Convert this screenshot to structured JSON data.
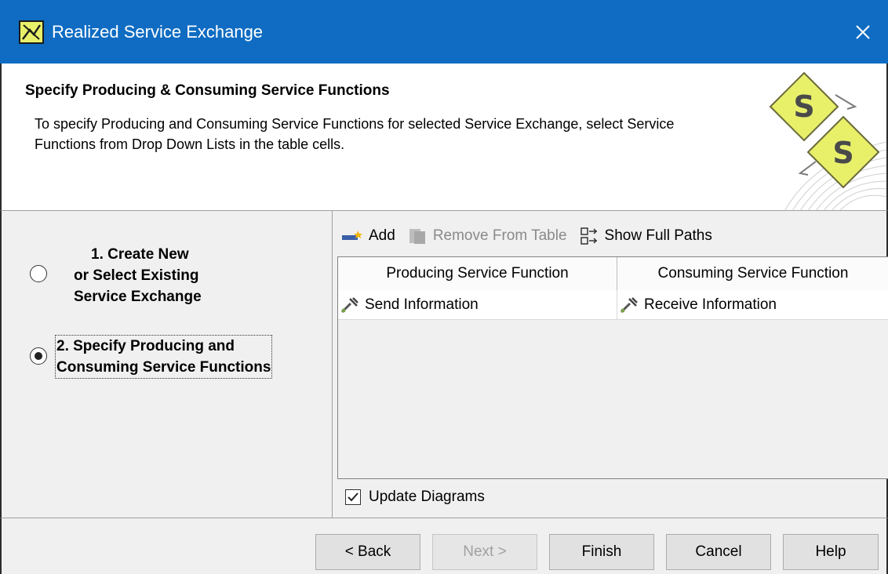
{
  "window": {
    "title": "Realized Service Exchange"
  },
  "header": {
    "title": "Specify Producing & Consuming Service Functions",
    "description": "To specify Producing and Consuming Service Functions for selected Service Exchange, select Service Functions from Drop Down Lists in the table cells."
  },
  "steps": [
    {
      "line1": "1. Create New",
      "line2": "or Select Existing",
      "line3": "Service Exchange",
      "selected": false
    },
    {
      "line1": "2. Specify Producing and",
      "line2": "Consuming Service Functions",
      "selected": true
    }
  ],
  "toolbar": {
    "add_label": "Add",
    "remove_label": "Remove From Table",
    "show_paths_label": "Show Full Paths"
  },
  "table": {
    "columns": [
      "Producing Service Function",
      "Consuming Service Function"
    ],
    "rows": [
      [
        "Send Information",
        "Receive Information"
      ]
    ]
  },
  "update_diagrams": {
    "label": "Update Diagrams",
    "checked": true
  },
  "buttons": {
    "back": "< Back",
    "next": "Next >",
    "finish": "Finish",
    "cancel": "Cancel",
    "help": "Help"
  },
  "colors": {
    "titlebar": "#0f6cc2",
    "logo_diamond": "#e8f06a"
  }
}
